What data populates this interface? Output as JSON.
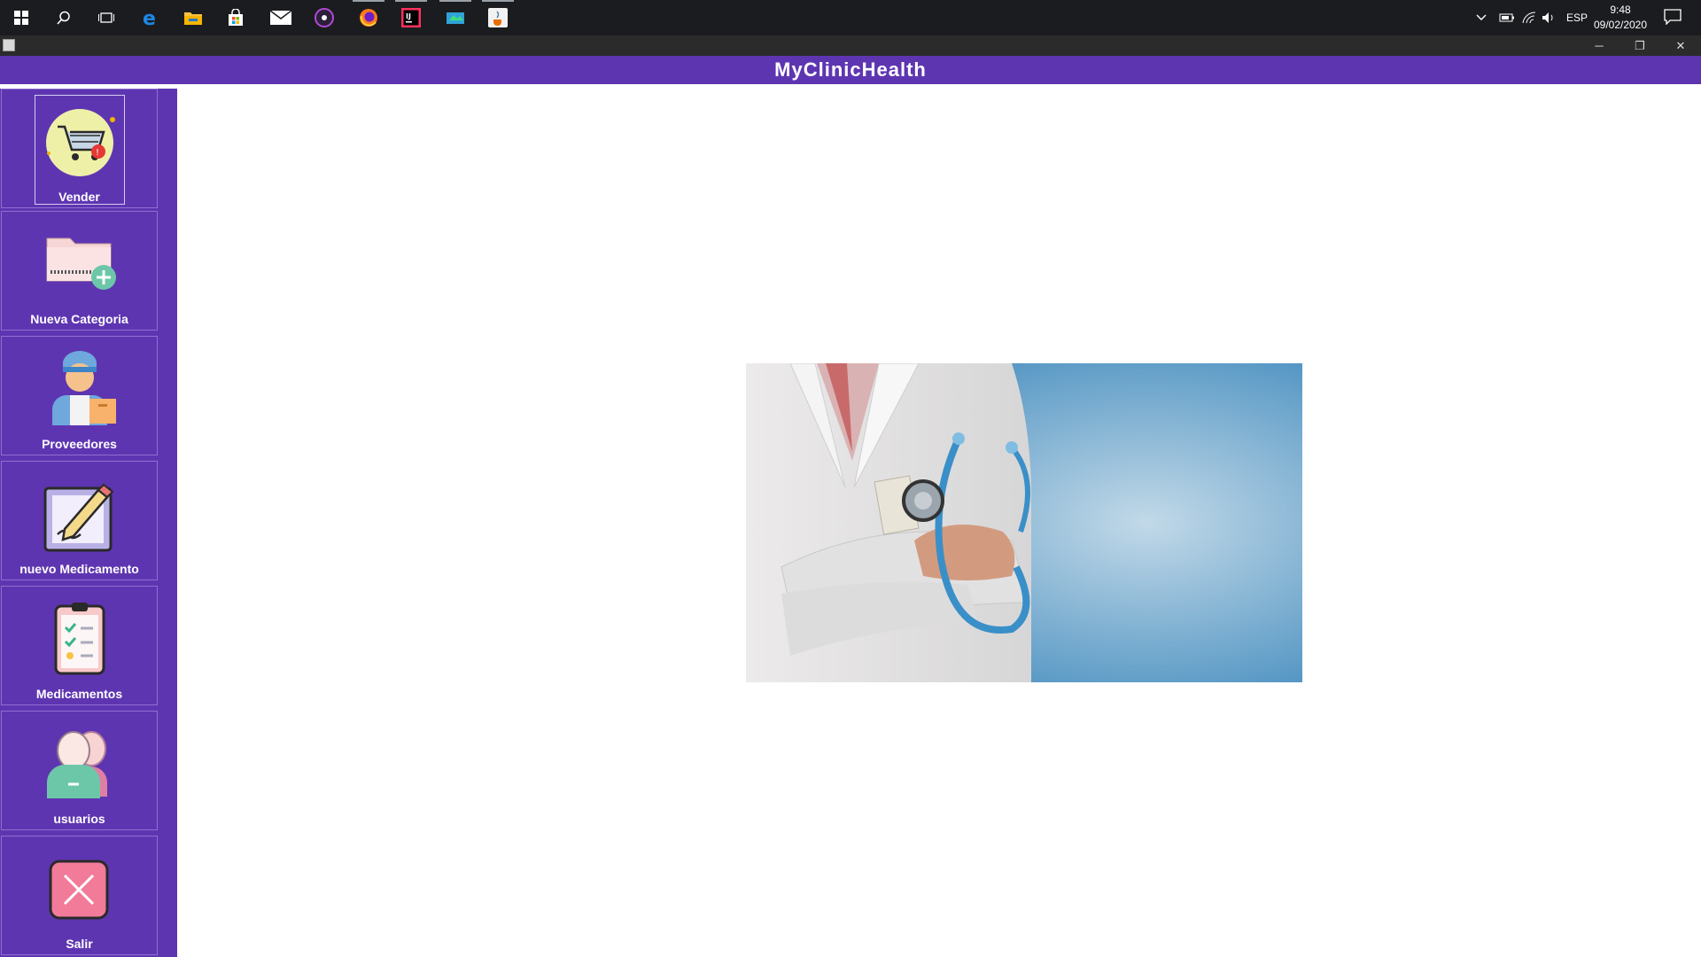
{
  "taskbar": {
    "icons": [
      {
        "name": "start-icon"
      },
      {
        "name": "search-icon"
      },
      {
        "name": "task-view-icon"
      },
      {
        "name": "edge-icon"
      },
      {
        "name": "file-explorer-icon"
      },
      {
        "name": "store-icon"
      },
      {
        "name": "mail-icon"
      },
      {
        "name": "media-icon"
      },
      {
        "name": "firefox-icon"
      },
      {
        "name": "intellij-icon"
      },
      {
        "name": "app-icon"
      },
      {
        "name": "java-icon"
      }
    ],
    "language": "ESP",
    "time": "9:48",
    "date": "09/02/2020"
  },
  "window": {
    "minimize_glyph": "─",
    "restore_glyph": "❐",
    "close_glyph": "✕"
  },
  "app": {
    "title": "MyClinicHealth"
  },
  "sidebar": {
    "items": [
      {
        "label": "Vender",
        "icon": "shopping-cart-icon"
      },
      {
        "label": "Nueva Categoria",
        "icon": "folder-add-icon"
      },
      {
        "label": "Proveedores",
        "icon": "delivery-person-icon"
      },
      {
        "label": "nuevo Medicamento",
        "icon": "edit-document-icon"
      },
      {
        "label": "Medicamentos",
        "icon": "clipboard-checklist-icon"
      },
      {
        "label": "usuarios",
        "icon": "users-icon"
      },
      {
        "label": "Salir",
        "icon": "close-box-icon"
      }
    ]
  },
  "colors": {
    "brand": "#5e35b1",
    "taskbar": "#1b1c1f"
  }
}
